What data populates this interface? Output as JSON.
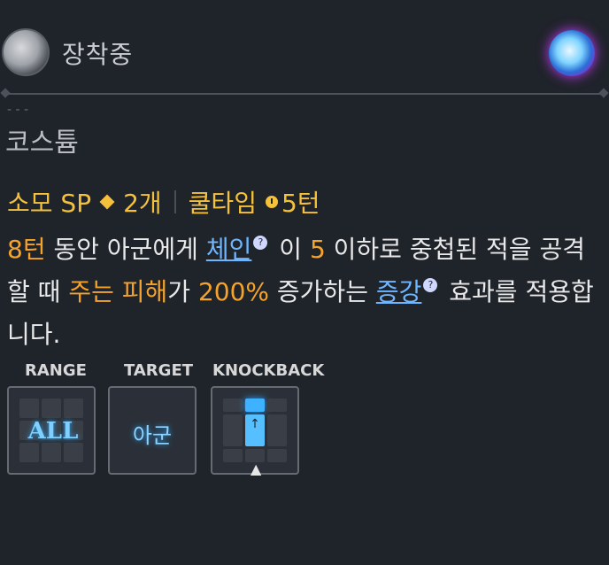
{
  "header": {
    "equip_label": "장착중"
  },
  "section": {
    "title": "코스튬",
    "dots": "- - -"
  },
  "cost": {
    "sp_label": "소모 SP",
    "sp_value": "2개",
    "cooldown_label": "쿨타임",
    "cooldown_value": "5턴"
  },
  "description": {
    "p1": "8턴",
    "p2": " 동안 아군에게 ",
    "kw1": "체인",
    "p3": " 이 ",
    "p4": "5",
    "p5": " 이하로 중첩된 적을 공격할 때 ",
    "p6": "주는 피해",
    "p7": "가 ",
    "p8": "200%",
    "p9": " 증가하는 ",
    "kw2": "증강",
    "p10": " 효과를 적용합니다."
  },
  "panels": {
    "range_label": "RANGE",
    "range_value": "ALL",
    "target_label": "TARGET",
    "target_value": "아군",
    "knockback_label": "KNOCKBACK"
  },
  "icons": [
    "character-avatar-icon",
    "element-orb-icon",
    "diamond-icon",
    "clock-icon",
    "help-icon",
    "up-arrow-icon",
    "caret-up-icon"
  ],
  "colors": {
    "accent": "#f6a32a",
    "keyword": "#6fb6ff",
    "background": "#1f232a"
  }
}
